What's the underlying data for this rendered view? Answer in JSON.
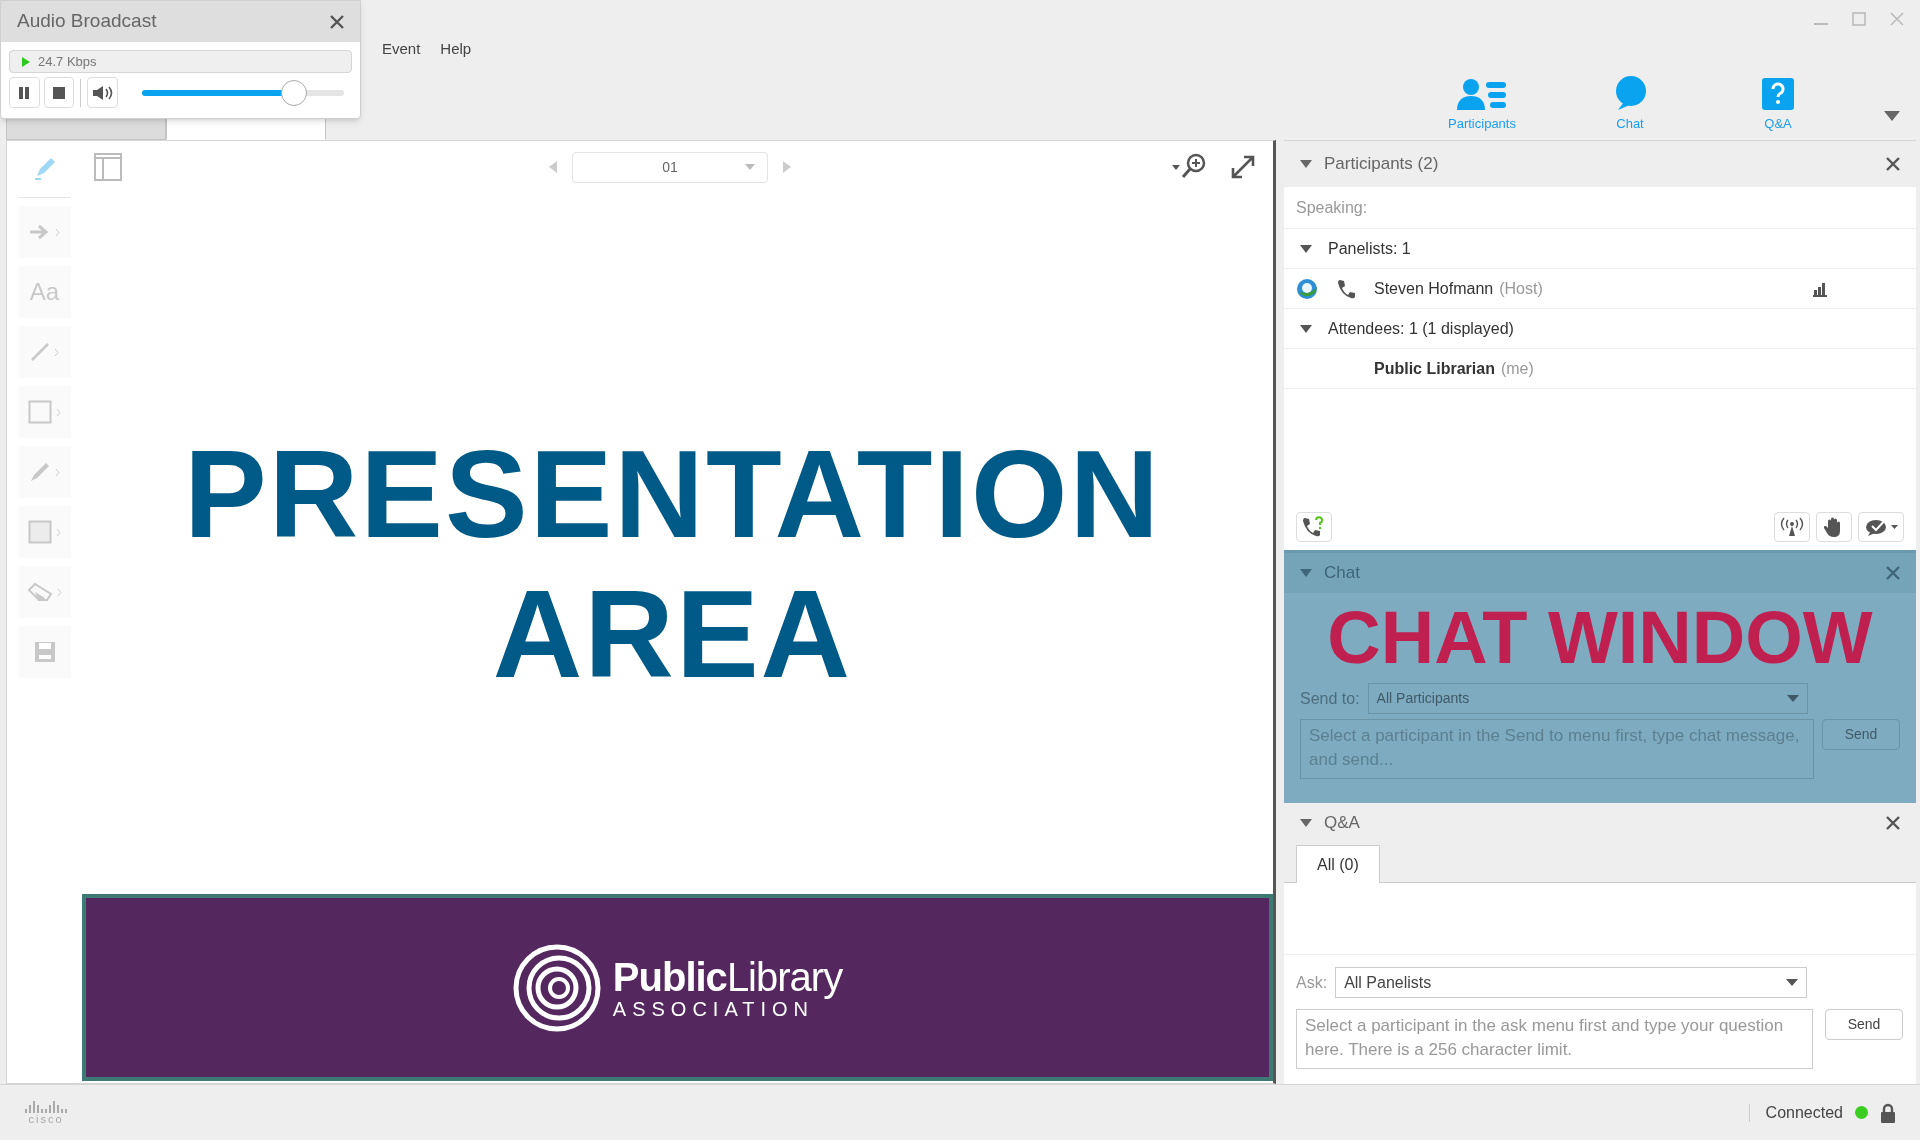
{
  "audio_broadcast": {
    "title": "Audio Broadcast",
    "bitrate": "24.7 Kbps",
    "volume": {
      "level": 0.75
    }
  },
  "menu": [
    {
      "label": "Event"
    },
    {
      "label": "Help"
    }
  ],
  "doc_tabs": [
    {
      "selected": false
    },
    {
      "selected": true
    }
  ],
  "nav": [
    {
      "kind": "participants",
      "label": "Participants"
    },
    {
      "kind": "chat",
      "label": "Chat"
    },
    {
      "kind": "qa",
      "label": "Q&A"
    }
  ],
  "presentation": {
    "page": "01",
    "tools": [
      {
        "kind": "highlighter",
        "selected": true
      },
      {
        "kind": "arrow"
      },
      {
        "kind": "text",
        "label": "Aa"
      },
      {
        "kind": "line"
      },
      {
        "kind": "rect"
      },
      {
        "kind": "pen"
      },
      {
        "kind": "fill"
      },
      {
        "kind": "eraser"
      },
      {
        "kind": "save"
      }
    ],
    "slide": {
      "lines": [
        "PRESENTATION",
        "AREA"
      ],
      "logo": "**Public**Library",
      "logo_sub": "ASSOCIATION"
    }
  },
  "participants": {
    "title": "Participants (2)",
    "expanded": true,
    "speaking": "Speaking:",
    "groups": [
      {
        "label": "Panelists: 1",
        "expanded": true,
        "members": [
          {
            "name": "Steven Hofmann",
            "tag": "(Host)",
            "me": false,
            "presence": true,
            "phone": true,
            "signal": true
          }
        ]
      },
      {
        "label": "Attendees: 1 (1 displayed)",
        "expanded": true,
        "members": [
          {
            "name": "Public Librarian",
            "tag": "(me)",
            "me": true,
            "presence": false,
            "phone": false,
            "signal": false
          }
        ]
      }
    ]
  },
  "chat": {
    "title": "Chat",
    "expanded": true,
    "overlay": "CHAT WINDOW",
    "send_to_label": "Send to:",
    "send_to": "All Participants",
    "placeholder": "Select a participant in the Send to menu first, type chat message, and send...",
    "send": "Send"
  },
  "qa": {
    "title": "Q&A",
    "expanded": true,
    "tabs": [
      {
        "label": "All (0)",
        "selected": true
      }
    ],
    "ask_label": "Ask:",
    "ask": "All Panelists",
    "placeholder": "Select a participant in the ask menu first and type your question here. There is a 256 character limit.",
    "send": "Send"
  },
  "status_bar": {
    "logo": "cisco",
    "status": "Connected"
  }
}
